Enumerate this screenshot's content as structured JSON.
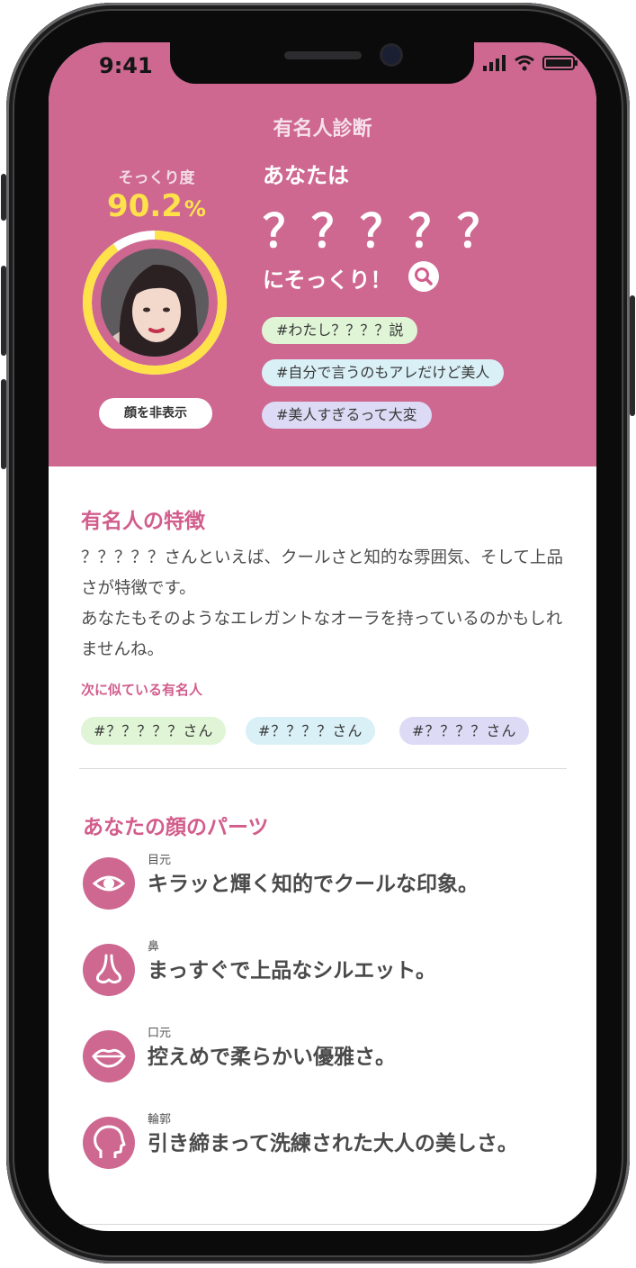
{
  "status": {
    "time": "9:41"
  },
  "header": {
    "app_title": "有名人診断",
    "match_label": "そっくり度",
    "match_value": "90.2",
    "match_unit": "%",
    "match_ratio": 0.902,
    "hide_face_label": "顔を非表示",
    "result_prefix": "あなたは",
    "result_name": "？？？？？",
    "result_suffix": "にそっくり！",
    "tags": [
      "#わたし？？？？説",
      "#自分で言うのもアレだけど美人",
      "#美人すぎるって大変"
    ]
  },
  "features": {
    "title": "有名人の特徴",
    "description": "？？？？？さんといえば、クールさと知的な雰囲気、そして上品さが特徴です。\nあなたもそのようなエレガントなオーラを持っているのかもしれませんね。",
    "similar_title": "次に似ている有名人",
    "similar": [
      "#？？？？？さん",
      "#？？？？さん",
      "#？？？？さん"
    ]
  },
  "parts": {
    "title": "あなたの顔のパーツ",
    "items": [
      {
        "label": "目元",
        "text": "キラッと輝く知的でクールな印象。",
        "icon": "eye-icon"
      },
      {
        "label": "鼻",
        "text": "まっすぐで上品なシルエット。",
        "icon": "nose-icon"
      },
      {
        "label": "口元",
        "text": "控えめで柔らかい優雅さ。",
        "icon": "lips-icon"
      },
      {
        "label": "輪郭",
        "text": "引き締まって洗練された大人の美しさ。",
        "icon": "face-outline-icon"
      }
    ]
  },
  "colors": {
    "header_bg": "#ce6891",
    "accent": "#d25d8c",
    "ring": "#ffe24a",
    "tag_green": "#dff5d6",
    "tag_blue": "#d9f0f7",
    "tag_purple": "#dcdaf5"
  }
}
